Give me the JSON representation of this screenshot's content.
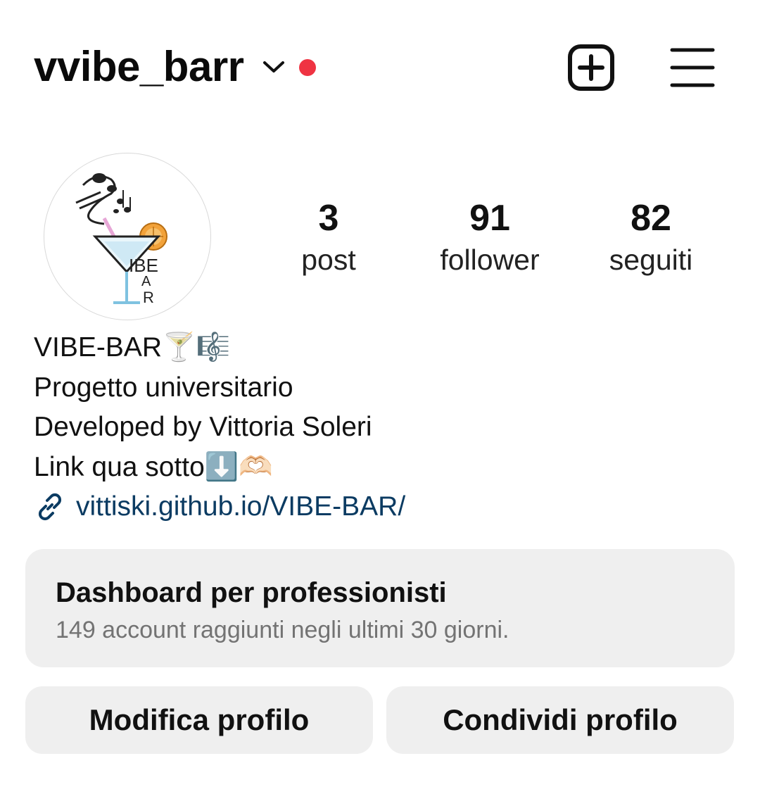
{
  "header": {
    "username": "vvibe_barr",
    "icons": {
      "dropdown": "chevron-down-icon",
      "notification": "red-dot-indicator",
      "create": "plus-square-icon",
      "menu": "hamburger-menu-icon"
    },
    "notification_color": "#ef3342"
  },
  "profile": {
    "avatar_logo": "VIBE-BAR cocktail glass logo with music notes",
    "stats": [
      {
        "value": "3",
        "label": "post"
      },
      {
        "value": "91",
        "label": "follower"
      },
      {
        "value": "82",
        "label": "seguiti"
      }
    ]
  },
  "bio": {
    "name": "VIBE-BAR🍸🎼",
    "lines": [
      "Progetto universitario",
      "Developed by Vittoria Soleri",
      "Link qua sotto⬇️🫶🏻"
    ],
    "link": "vittiski.github.io/VIBE-BAR/",
    "link_color": "#0b3b62"
  },
  "dashboard": {
    "title": "Dashboard per professionisti",
    "subtitle": "149 account raggiunti negli ultimi 30 giorni."
  },
  "actions": {
    "edit_label": "Modifica profilo",
    "share_label": "Condividi profilo"
  }
}
